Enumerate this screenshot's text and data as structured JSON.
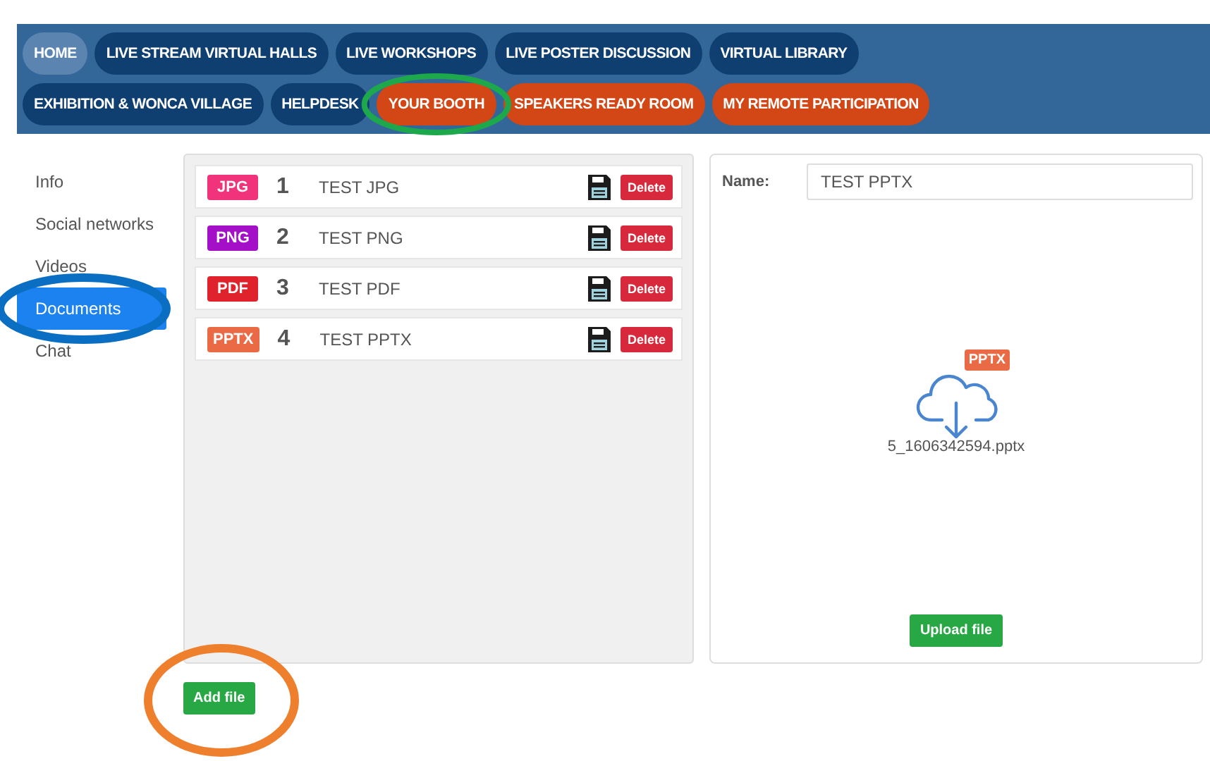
{
  "nav": [
    {
      "label": "HOME",
      "kind": "plain",
      "selected": true
    },
    {
      "label": "LIVE STREAM VIRTUAL HALLS",
      "kind": "plain",
      "selected": false
    },
    {
      "label": "LIVE WORKSHOPS",
      "kind": "plain",
      "selected": false
    },
    {
      "label": "LIVE POSTER DISCUSSION",
      "kind": "plain",
      "selected": false
    },
    {
      "label": "VIRTUAL LIBRARY",
      "kind": "plain",
      "selected": false
    },
    {
      "label": "EXHIBITION & WONCA VILLAGE",
      "kind": "plain",
      "selected": false
    },
    {
      "label": "HELPDESK",
      "kind": "plain",
      "selected": false
    },
    {
      "label": "YOUR BOOTH",
      "kind": "accent",
      "selected": false
    },
    {
      "label": "SPEAKERS READY ROOM",
      "kind": "accent",
      "selected": false
    },
    {
      "label": "MY REMOTE PARTICIPATION",
      "kind": "accent",
      "selected": false
    }
  ],
  "sidebar": {
    "items": [
      {
        "label": "Info",
        "selected": false
      },
      {
        "label": "Social networks",
        "selected": false
      },
      {
        "label": "Videos",
        "selected": false
      },
      {
        "label": "Documents",
        "selected": true
      },
      {
        "label": "Chat",
        "selected": false
      }
    ]
  },
  "documents": [
    {
      "type": "JPG",
      "color": "#f0337a",
      "number": "1",
      "name": "TEST JPG",
      "action": "Delete"
    },
    {
      "type": "PNG",
      "color": "#a310c8",
      "number": "2",
      "name": "TEST PNG",
      "action": "Delete"
    },
    {
      "type": "PDF",
      "color": "#e0222c",
      "number": "3",
      "name": "TEST PDF",
      "action": "Delete"
    },
    {
      "type": "PPTX",
      "color": "#ea6a45",
      "number": "4",
      "name": "TEST PPTX",
      "action": "Delete"
    }
  ],
  "add_button": "Add file",
  "detail": {
    "name_label": "Name:",
    "name_value": "TEST PPTX",
    "file_badge": {
      "label": "PPTX",
      "color": "#ea6a45"
    },
    "file_name": "5_1606342594.pptx",
    "upload_button": "Upload file"
  },
  "annotations": [
    {
      "color": "#1ea84c"
    },
    {
      "color": "#0a6fc2"
    },
    {
      "color": "#ee7f2d"
    }
  ]
}
